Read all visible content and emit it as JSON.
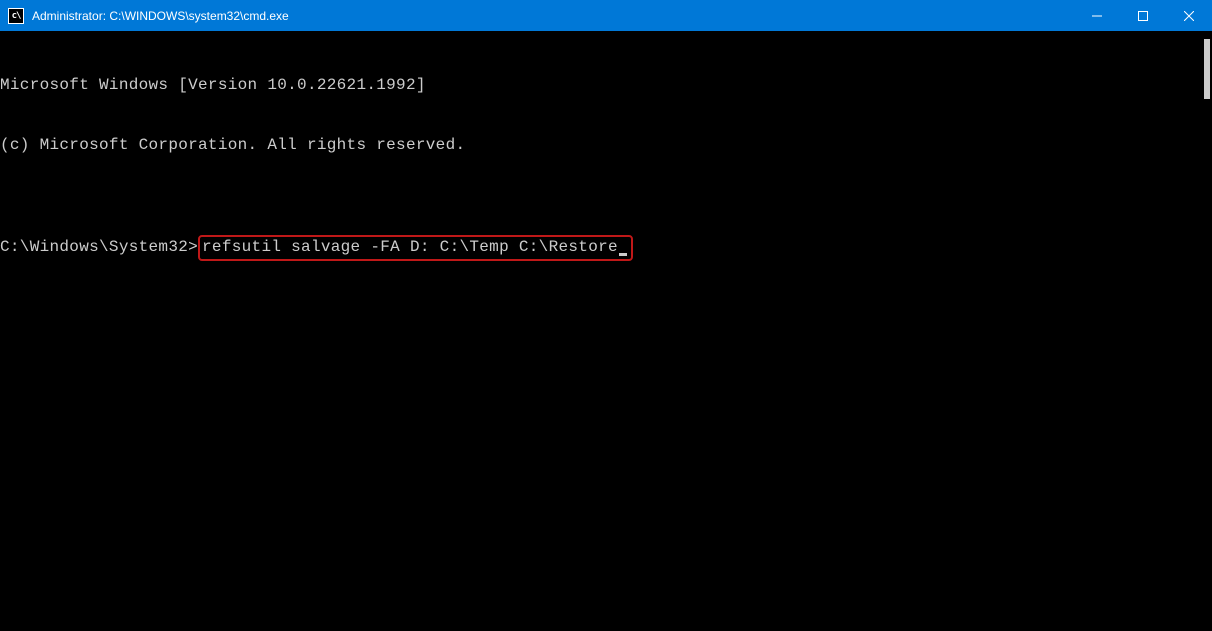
{
  "titlebar": {
    "icon_text": "C:\\",
    "title": "Administrator: C:\\WINDOWS\\system32\\cmd.exe"
  },
  "terminal": {
    "line1": "Microsoft Windows [Version 10.0.22621.1992]",
    "line2": "(c) Microsoft Corporation. All rights reserved.",
    "blank": "",
    "prompt": "C:\\Windows\\System32>",
    "command": "refsutil salvage -FA D: C:\\Temp C:\\Restore"
  }
}
